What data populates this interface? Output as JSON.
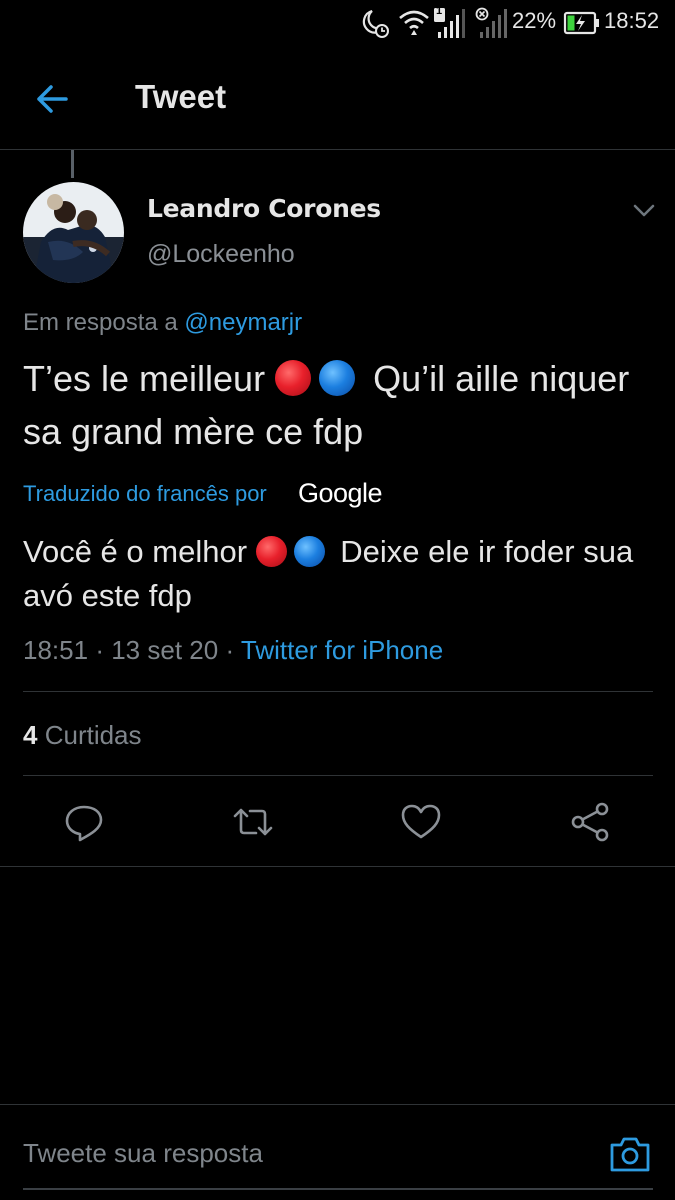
{
  "status_bar": {
    "battery_percent": "22%",
    "time": "18:52",
    "sim_badge": "1",
    "icons": [
      "do-not-disturb-moon-icon",
      "alarm-icon",
      "wifi-icon",
      "signal-icon",
      "signal-no-sim-icon",
      "battery-charging-icon"
    ]
  },
  "header": {
    "title": "Tweet",
    "back_icon": "arrow-left-icon"
  },
  "tweet": {
    "author_name": "Leandro Corones",
    "author_handle": "@Lockeenho",
    "reply_prefix": "Em resposta a",
    "reply_to": "@neymarjr",
    "text_part1": "T’es le meilleur",
    "text_part2": "Qu’il aille niquer sa grand mère ce fdp",
    "translated_by": "Traduzido do francês por",
    "translator": "Google",
    "translation_part1": "Você é o melhor",
    "translation_part2": "Deixe ele ir foder sua avó este fdp",
    "time": "18:51",
    "date": "13 set 20",
    "source": "Twitter for iPhone",
    "separator": "·",
    "likes_count": "4",
    "likes_label": "Curtidas",
    "emoji_colors": {
      "red": "#e8202b",
      "blue": "#1c7fe0"
    }
  },
  "actions": [
    "reply-icon",
    "retweet-icon",
    "like-heart-icon",
    "share-icon"
  ],
  "compose": {
    "placeholder": "Tweete sua resposta",
    "camera_icon": "camera-icon"
  },
  "colors": {
    "accent": "#1d9bf0",
    "background": "#000000",
    "divider": "#2f3336",
    "muted_text": "#7f858b"
  }
}
